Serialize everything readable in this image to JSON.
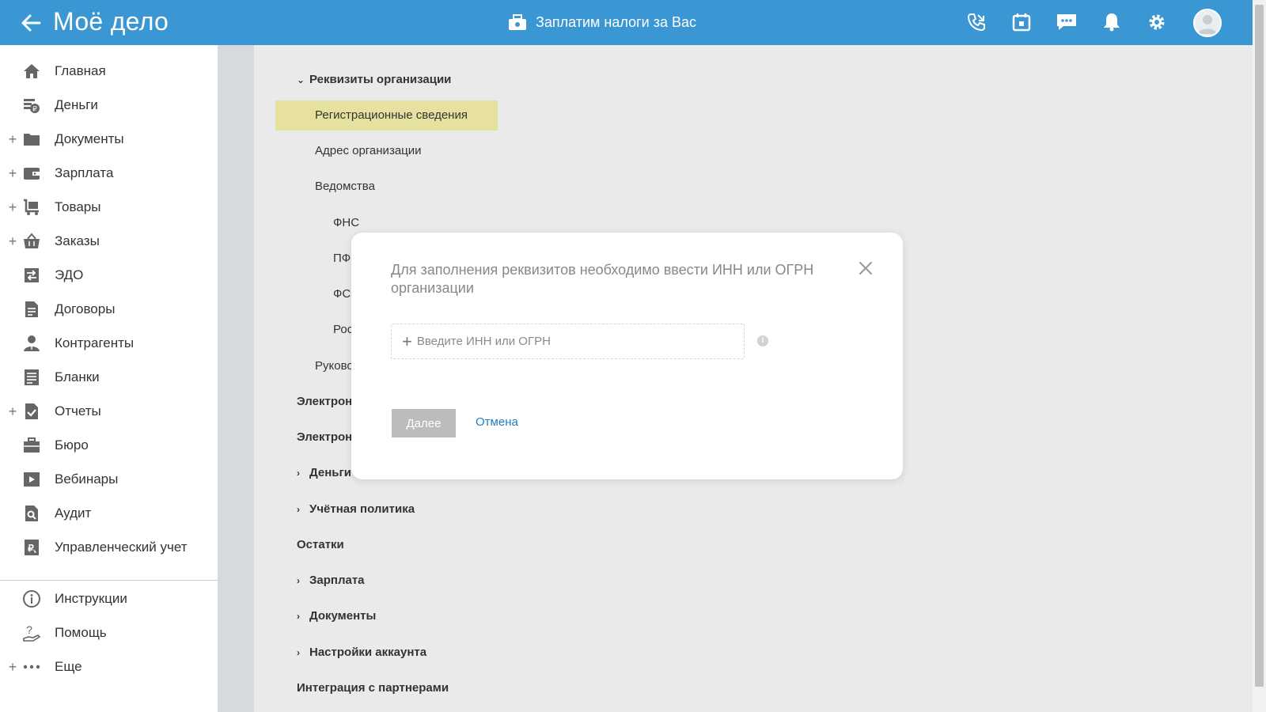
{
  "header": {
    "logo": "Моё дело",
    "promo": "Заплатим налоги за Вас",
    "icons": [
      "phone-icon",
      "calendar-icon",
      "chat-icon",
      "bell-icon",
      "gear-icon",
      "avatar"
    ]
  },
  "sidebar": {
    "items": [
      {
        "label": "Главная",
        "icon": "home-icon",
        "expandable": false
      },
      {
        "label": "Деньги",
        "icon": "money-icon",
        "expandable": false
      },
      {
        "label": "Документы",
        "icon": "folder-icon",
        "expandable": true
      },
      {
        "label": "Зарплата",
        "icon": "wallet-icon",
        "expandable": true
      },
      {
        "label": "Товары",
        "icon": "cart-icon",
        "expandable": true
      },
      {
        "label": "Заказы",
        "icon": "basket-icon",
        "expandable": true
      },
      {
        "label": "ЭДО",
        "icon": "edo-icon",
        "expandable": false
      },
      {
        "label": "Договоры",
        "icon": "contract-icon",
        "expandable": false
      },
      {
        "label": "Контрагенты",
        "icon": "person-icon",
        "expandable": false
      },
      {
        "label": "Бланки",
        "icon": "form-icon",
        "expandable": false
      },
      {
        "label": "Отчеты",
        "icon": "report-icon",
        "expandable": true
      },
      {
        "label": "Бюро",
        "icon": "briefcase-icon",
        "expandable": false
      },
      {
        "label": "Вебинары",
        "icon": "webinar-icon",
        "expandable": false
      },
      {
        "label": "Аудит",
        "icon": "audit-icon",
        "expandable": false
      },
      {
        "label": "Управленческий учет",
        "icon": "management-icon",
        "expandable": false
      }
    ],
    "bottom": [
      {
        "label": "Инструкции",
        "icon": "info-icon",
        "expandable": false
      },
      {
        "label": "Помощь",
        "icon": "help-icon",
        "expandable": false
      },
      {
        "label": "Еще",
        "icon": "more-icon",
        "expandable": true
      }
    ]
  },
  "tree": {
    "section_requisites": "Реквизиты организации",
    "registration": "Регистрационные сведения",
    "address": "Адрес организации",
    "agencies": "Ведомства",
    "fns": "ФНС",
    "pf": "ПФ",
    "fs": "ФС",
    "ros": "Рос",
    "head": "Руково",
    "electron1": "Электрон",
    "electron2": "Электрон",
    "money": "Деньги",
    "accounting_policy": "Учётная политика",
    "balances": "Остатки",
    "salary": "Зарплата",
    "documents": "Документы",
    "account_settings": "Настройки аккаунта",
    "integration": "Интеграция с партнерами"
  },
  "modal": {
    "title": "Для заполнения реквизитов необходимо ввести ИНН или ОГРН организации",
    "input_placeholder": "Введите ИНН или ОГРН",
    "info": "i",
    "next_label": "Далее",
    "cancel_label": "Отмена"
  }
}
